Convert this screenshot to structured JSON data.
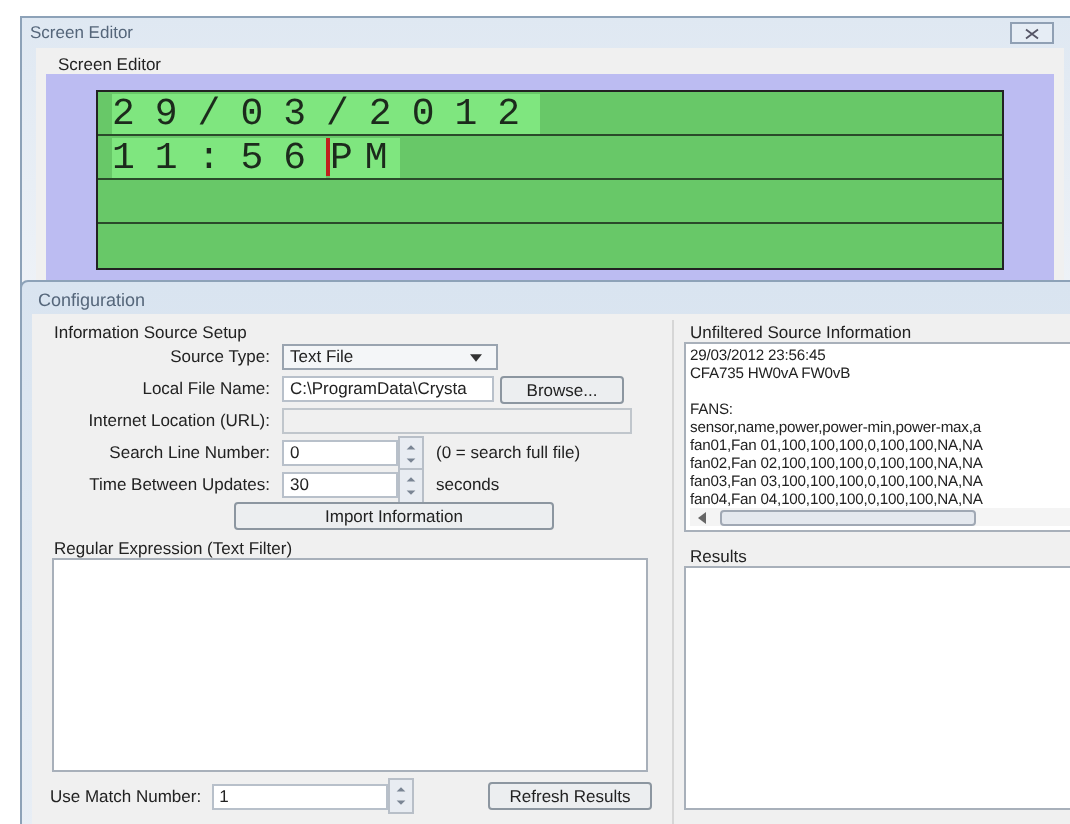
{
  "editor_window": {
    "title": "Screen Editor",
    "group_label": "Screen Editor"
  },
  "lcd": {
    "lines": [
      {
        "text": "29/03/2012",
        "cursor": false
      },
      {
        "text": "11:56",
        "cursor": true,
        "rest": "PM"
      }
    ]
  },
  "config_window": {
    "title": "Configuration"
  },
  "source_setup": {
    "title": "Information Source Setup",
    "source_type": {
      "label": "Source Type:",
      "value": "Text File"
    },
    "local_file": {
      "label": "Local File Name:",
      "value": "C:\\ProgramData\\Crysta",
      "button": "Browse..."
    },
    "internet_location": {
      "label": "Internet Location (URL):",
      "disabled": true
    },
    "search_line": {
      "label": "Search Line Number:",
      "value": "0",
      "hint": "(0 = search full file)"
    },
    "update_time": {
      "label": "Time Between Updates:",
      "value": "30",
      "unit": "seconds"
    },
    "import_button": "Import Information"
  },
  "unfiltered": {
    "title": "Unfiltered Source Information",
    "blocks": [
      [
        "29/03/2012 23:56:45",
        "CFA735 HW0vA FW0vB"
      ],
      [
        "FANS:",
        "sensor,name,power,power-min,power-max,a",
        "fan01,Fan 01,100,100,100,0,100,100,NA,NA",
        "fan02,Fan 02,100,100,100,0,100,100,NA,NA",
        "fan03,Fan 03,100,100,100,0,100,100,NA,NA",
        "fan04,Fan 04,100,100,100,0,100,100,NA,NA"
      ]
    ]
  },
  "regex": {
    "title": "Regular Expression (Text Filter)",
    "match_label": "Use Match Number:",
    "match_value": "1",
    "refresh_button": "Refresh Results"
  },
  "results": {
    "title": "Results"
  }
}
